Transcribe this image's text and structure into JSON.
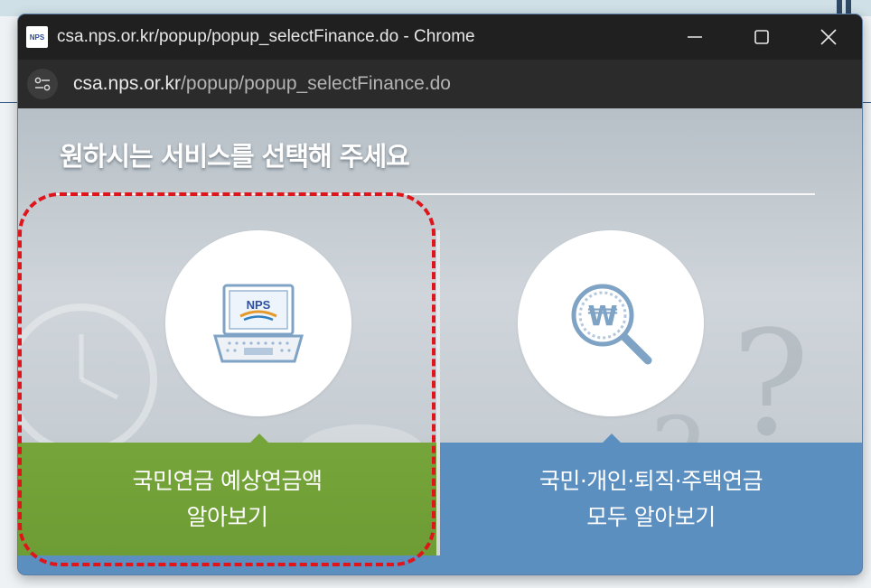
{
  "window": {
    "title": "csa.nps.or.kr/popup/popup_selectFinance.do - Chrome",
    "favicon_text": "NPS",
    "controls": [
      "minimize-icon",
      "maximize-icon",
      "close-icon"
    ]
  },
  "address": {
    "host": "csa.nps.or.kr",
    "path": "/popup/popup_selectFinance.do",
    "site_info_icon": "tune-icon"
  },
  "content": {
    "heading": "원하시는 서비스를 선택해 주세요",
    "options": [
      {
        "icon": "laptop-icon",
        "icon_label": "NPS",
        "line1": "국민연금 예상연금액",
        "line2": "알아보기",
        "color": "#75a53a"
      },
      {
        "icon": "magnifier-won-icon",
        "icon_label": "₩",
        "line1": "국민·개인·퇴직·주택연금",
        "line2": "모두 알아보기",
        "color": "#5b8fc0"
      }
    ]
  },
  "highlight": {
    "color": "#e0151b",
    "style": "dashed"
  }
}
